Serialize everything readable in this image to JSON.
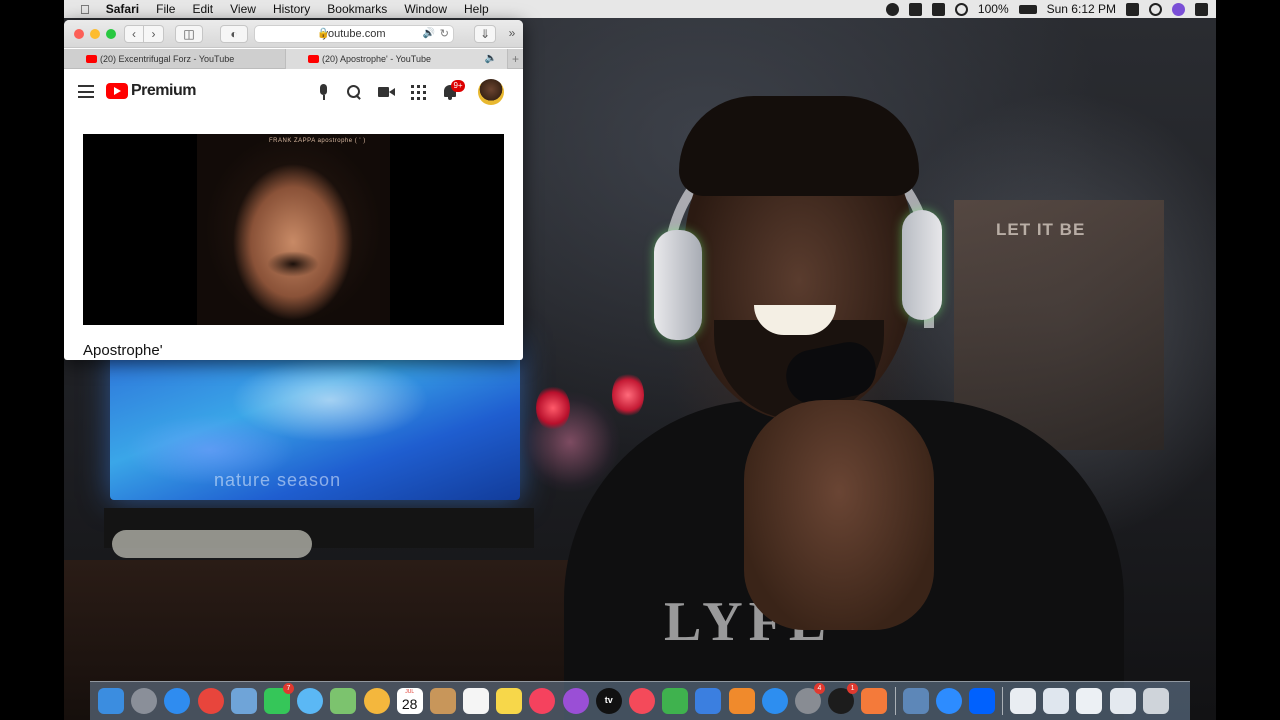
{
  "menubar": {
    "app_name": "Safari",
    "menus": [
      "File",
      "Edit",
      "View",
      "History",
      "Bookmarks",
      "Window",
      "Help"
    ],
    "battery": "100%",
    "clock": "Sun 6:12 PM"
  },
  "safari": {
    "address": "youtube.com",
    "tabs": [
      {
        "title": "(20) Excentrifugal Forz - YouTube",
        "active": false
      },
      {
        "title": "(20) Apostrophe' - YouTube",
        "active": true
      }
    ]
  },
  "youtube": {
    "logo_text": "Premium",
    "notification_count": "9+",
    "album_cover_text": "FRANK ZAPPA  apostrophe ( ' )",
    "video_title": "Apostrophe'"
  },
  "webcam": {
    "tv_text": "nature  season",
    "poster_text": "LET IT BE",
    "shirt_text": "LYFE"
  },
  "dock": {
    "calendar_month": "JUL",
    "calendar_day": "28",
    "facetime_badge": "7",
    "settings_badge": "4",
    "news_badge": "1",
    "tv_label": "tv",
    "icons": [
      {
        "name": "finder-icon",
        "color": "#3b8de0"
      },
      {
        "name": "launchpad-icon",
        "color": "#8a8f99"
      },
      {
        "name": "safari-icon",
        "color": "#2f8cf0"
      },
      {
        "name": "chrome-icon",
        "color": "#e8453c"
      },
      {
        "name": "preview-icon",
        "color": "#6fa4d8"
      },
      {
        "name": "facetime-icon",
        "color": "#35c659"
      },
      {
        "name": "messages-icon",
        "color": "#5bb8f5"
      },
      {
        "name": "maps-icon",
        "color": "#7cc36e"
      },
      {
        "name": "photos-icon",
        "color": "#f4b73d"
      },
      {
        "name": "calendar-icon",
        "color": "#ffffff"
      },
      {
        "name": "contacts-icon",
        "color": "#c8965a"
      },
      {
        "name": "reminders-icon",
        "color": "#f5f5f5"
      },
      {
        "name": "notes-icon",
        "color": "#f7d74a"
      },
      {
        "name": "music-icon",
        "color": "#f5425e"
      },
      {
        "name": "podcasts-icon",
        "color": "#9a4fd6"
      },
      {
        "name": "apple-tv-icon",
        "color": "#111111"
      },
      {
        "name": "news-icon",
        "color": "#f44a5a"
      },
      {
        "name": "numbers-icon",
        "color": "#3fb24e"
      },
      {
        "name": "keynote-icon",
        "color": "#3b7fe0"
      },
      {
        "name": "pages-icon",
        "color": "#f08a2c"
      },
      {
        "name": "app-store-icon",
        "color": "#2d8ef0"
      },
      {
        "name": "system-preferences-icon",
        "color": "#888c93"
      },
      {
        "name": "quicktime-icon",
        "color": "#1c1c1c"
      },
      {
        "name": "screen-recorder-icon",
        "color": "#f47a3a"
      },
      {
        "name": "image-capture-icon",
        "color": "#5d87b8"
      },
      {
        "name": "zoom-icon",
        "color": "#2d8cff"
      },
      {
        "name": "dropbox-icon",
        "color": "#0061fe"
      },
      {
        "name": "window-thumb-1-icon",
        "color": "#e9edf2"
      },
      {
        "name": "window-thumb-2-icon",
        "color": "#dfe6ee"
      },
      {
        "name": "window-thumb-3-icon",
        "color": "#ecf0f4"
      },
      {
        "name": "window-thumb-4-icon",
        "color": "#e4e9ef"
      },
      {
        "name": "trash-icon",
        "color": "#cfd4da"
      }
    ]
  },
  "colors": {
    "youtube_red": "#ff0000",
    "badge_red": "#dd0000"
  }
}
